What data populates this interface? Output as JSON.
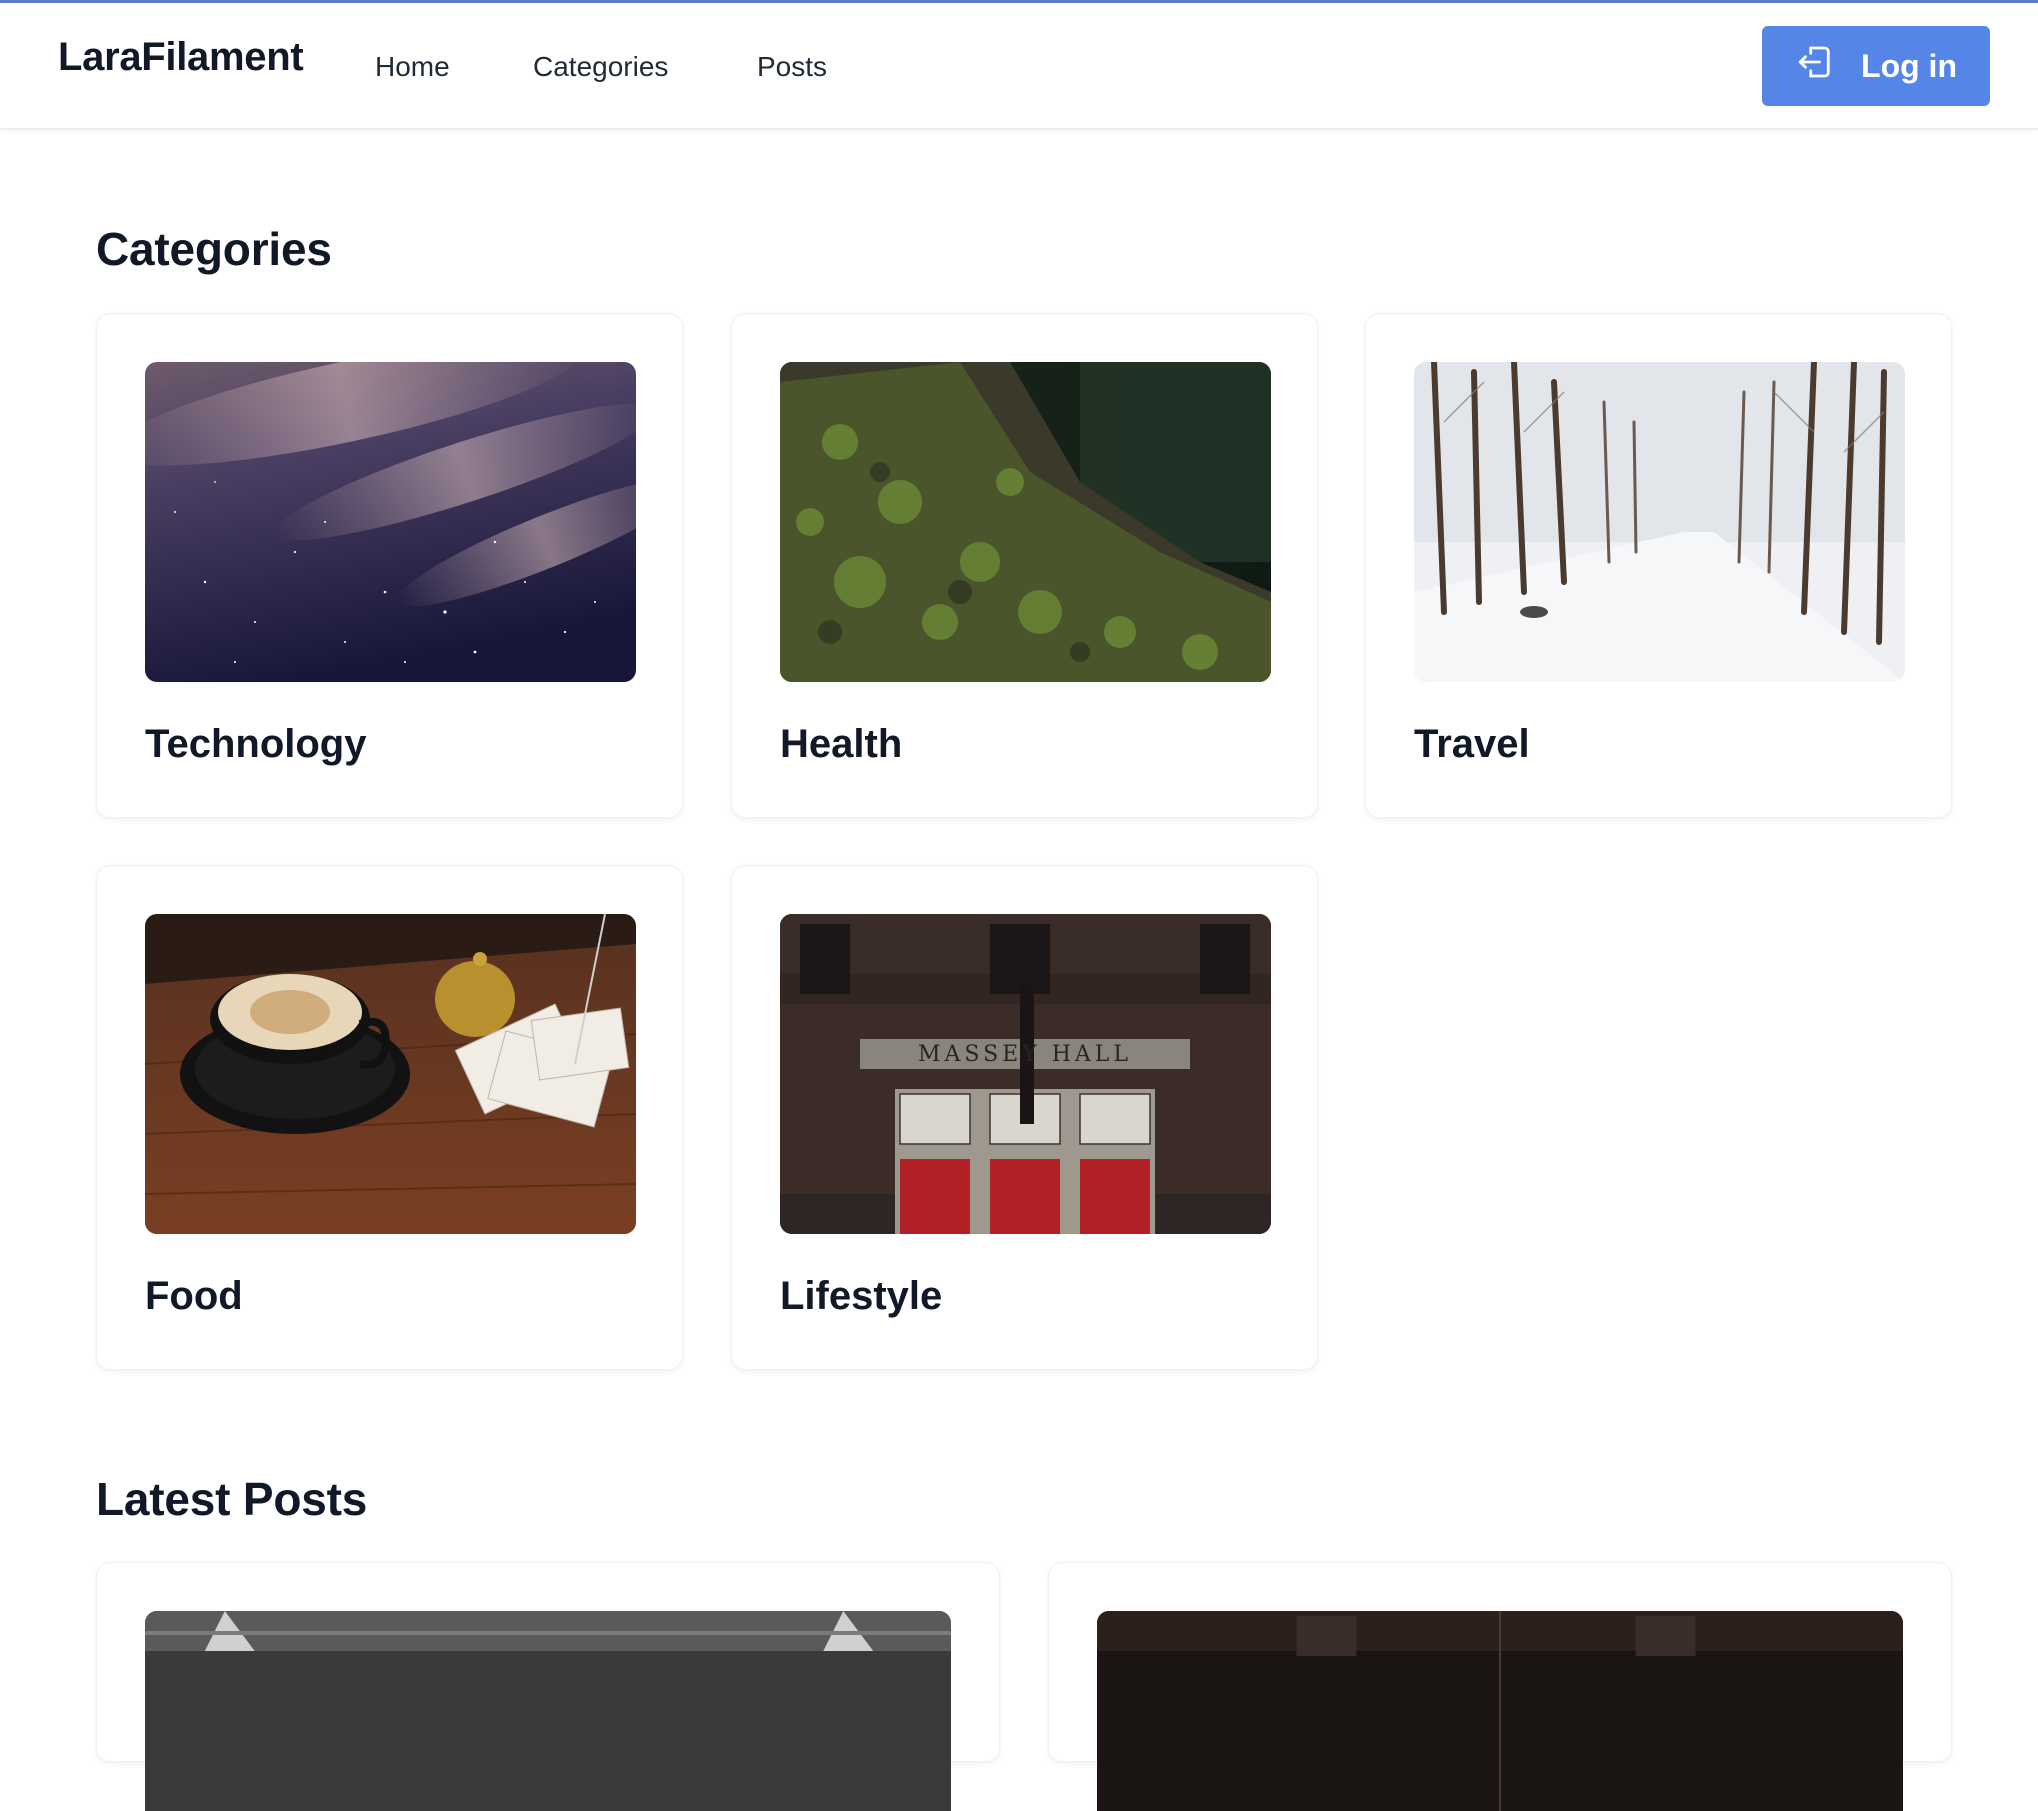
{
  "nav": {
    "brand": "LaraFilament",
    "links": [
      "Home",
      "Categories",
      "Posts"
    ],
    "login_label": "Log in",
    "login_icon": "login-icon",
    "accent_color": "#5585e6"
  },
  "categories": {
    "title": "Categories",
    "items": [
      {
        "label": "Technology",
        "image": "night-sky-photo"
      },
      {
        "label": "Health",
        "image": "mossy-tree-photo"
      },
      {
        "label": "Travel",
        "image": "snowy-road-photo"
      },
      {
        "label": "Food",
        "image": "latte-coffee-photo"
      },
      {
        "label": "Lifestyle",
        "image": "massey-hall-building-photo"
      }
    ]
  },
  "latest_posts": {
    "title": "Latest Posts",
    "items": [
      {
        "image": "grayscale-photo"
      },
      {
        "image": "dark-building-photo"
      }
    ]
  }
}
